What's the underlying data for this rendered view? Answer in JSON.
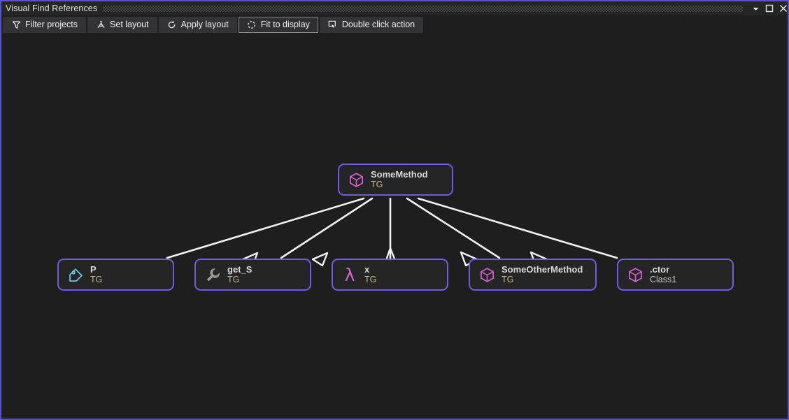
{
  "window": {
    "title": "Visual Find References",
    "controls": [
      {
        "name": "dropdown-button",
        "icon": "chevron-down-icon"
      },
      {
        "name": "maximize-button",
        "icon": "maximize-icon"
      },
      {
        "name": "close-button",
        "icon": "close-icon"
      }
    ]
  },
  "toolbar": {
    "buttons": [
      {
        "label": "Filter projects",
        "icon": "filter-funnel-icon",
        "outlined": false
      },
      {
        "label": "Set layout",
        "icon": "hierarchy-tree-icon",
        "outlined": false
      },
      {
        "label": "Apply layout",
        "icon": "refresh-icon",
        "outlined": false
      },
      {
        "label": "Fit to display",
        "icon": "fit-to-display-icon",
        "outlined": true
      },
      {
        "label": "Double click action",
        "icon": "cursor-click-icon",
        "outlined": false
      }
    ]
  },
  "graph": {
    "root": {
      "title": "SomeMethod",
      "subtitle": "TG",
      "icon": "cube-icon",
      "sub_style": "accent"
    },
    "children": [
      {
        "title": "P",
        "subtitle": "TG",
        "icon": "tag-icon",
        "sub_style": "accent"
      },
      {
        "title": "get_S",
        "subtitle": "TG",
        "icon": "wrench-icon",
        "sub_style": "accent"
      },
      {
        "title": "x",
        "subtitle": "TG",
        "icon": "lambda-icon",
        "sub_style": "accent"
      },
      {
        "title": "SomeOtherMethod",
        "subtitle": "TG",
        "icon": "cube-icon",
        "sub_style": "accent"
      },
      {
        "title": ".ctor",
        "subtitle": "Class1",
        "icon": "cube-icon",
        "sub_style": "plain"
      }
    ]
  },
  "colors": {
    "window_border": "#5b52c4",
    "node_border": "#6f5ce0",
    "node_background": "#252526",
    "canvas_background": "#1e1e1e",
    "edge": "#f2f2f2",
    "cube_icon": "#d35fd3",
    "tag_icon": "#6fc7e8",
    "wrench_icon": "#9b9b9b",
    "lambda_icon": "#d661d6",
    "subtitle_accent": "#c9b88f",
    "subtitle_plain": "#c8c8c8",
    "title_text": "#d8d8d8"
  }
}
